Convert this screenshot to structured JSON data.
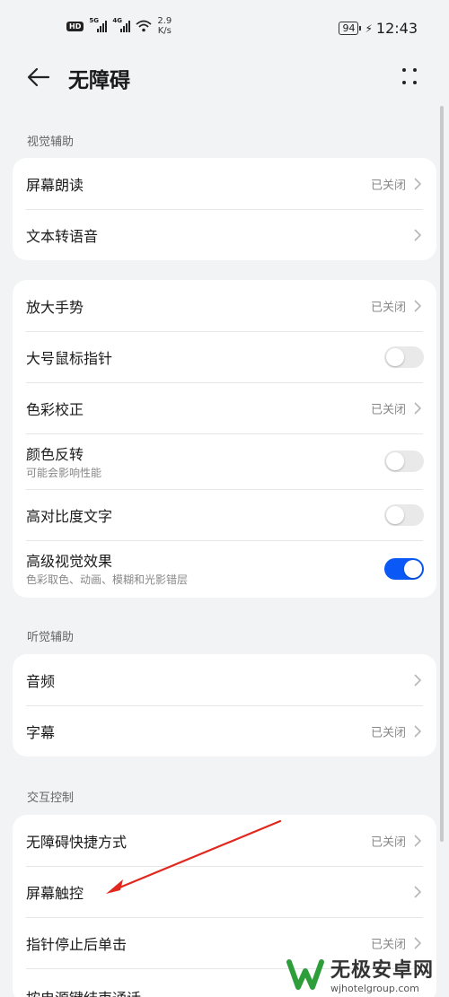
{
  "status_bar": {
    "badge": "HD",
    "sim1": "5G",
    "sim2": "4G",
    "speed_value": "2.9",
    "speed_unit": "K/s",
    "battery": "94",
    "time": "12:43"
  },
  "header": {
    "title": "无障碍"
  },
  "sections": [
    {
      "title": "视觉辅助"
    },
    {
      "title": "听觉辅助"
    },
    {
      "title": "交互控制"
    }
  ],
  "cards": {
    "vision_a": [
      {
        "label": "屏幕朗读",
        "value": "已关闭"
      },
      {
        "label": "文本转语音",
        "value": ""
      }
    ],
    "vision_b": [
      {
        "label": "放大手势",
        "value": "已关闭"
      },
      {
        "label": "大号鼠标指针",
        "toggle": false
      },
      {
        "label": "色彩校正",
        "value": "已关闭"
      },
      {
        "label": "颜色反转",
        "sub": "可能会影响性能",
        "toggle": false
      },
      {
        "label": "高对比度文字",
        "toggle": false
      },
      {
        "label": "高级视觉效果",
        "sub": "色彩取色、动画、模糊和光影错层",
        "toggle": true
      }
    ],
    "hearing": [
      {
        "label": "音频",
        "value": ""
      },
      {
        "label": "字幕",
        "value": "已关闭"
      }
    ],
    "interaction": [
      {
        "label": "无障碍快捷方式",
        "value": "已关闭"
      },
      {
        "label": "屏幕触控",
        "value": ""
      },
      {
        "label": "指针停止后单击",
        "value": "已关闭"
      },
      {
        "label": "按电源键结束通话",
        "value": ""
      }
    ]
  },
  "watermark": {
    "title": "无极安卓网",
    "url": "wjhotelgroup.com"
  },
  "colors": {
    "accent": "#0a59f7",
    "annotation": "#e0281e"
  }
}
